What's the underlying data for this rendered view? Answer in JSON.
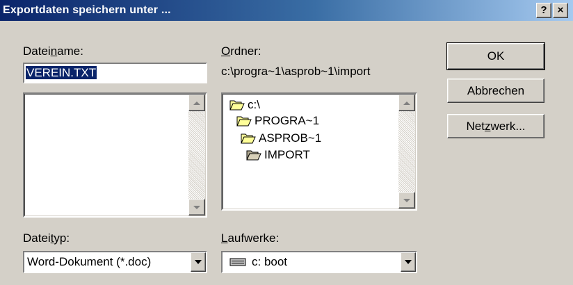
{
  "window": {
    "title": "Exportdaten speichern unter ...",
    "help_button": "?",
    "close_button": "×"
  },
  "filename": {
    "label_pre": "Datei",
    "label_key": "n",
    "label_post": "ame:",
    "value": "VEREIN.TXT",
    "file_list": []
  },
  "folder": {
    "label_key": "O",
    "label_post": "rdner:",
    "current_path": "c:\\progra~1\\asprob~1\\import",
    "tree": [
      {
        "name": "c:\\",
        "state": "open"
      },
      {
        "name": "PROGRA~1",
        "state": "open"
      },
      {
        "name": "ASPROB~1",
        "state": "open"
      },
      {
        "name": "IMPORT",
        "state": "open-selected"
      }
    ]
  },
  "filetype": {
    "label_pre": "Datei",
    "label_key": "t",
    "label_post": "yp:",
    "selected": "Word-Dokument (*.doc)"
  },
  "drives": {
    "label_key": "L",
    "label_post": "aufwerke:",
    "selected": "c: boot",
    "icon": "hard-drive-icon"
  },
  "buttons": {
    "ok": "OK",
    "cancel": "Abbrechen",
    "network_pre": "Net",
    "network_key": "z",
    "network_post": "werk..."
  },
  "colors": {
    "title_start": "#0a246a",
    "title_end": "#a6caf0",
    "face": "#d4d0c8",
    "selection": "#0a246a",
    "folder_yellow": "#ffff99"
  }
}
